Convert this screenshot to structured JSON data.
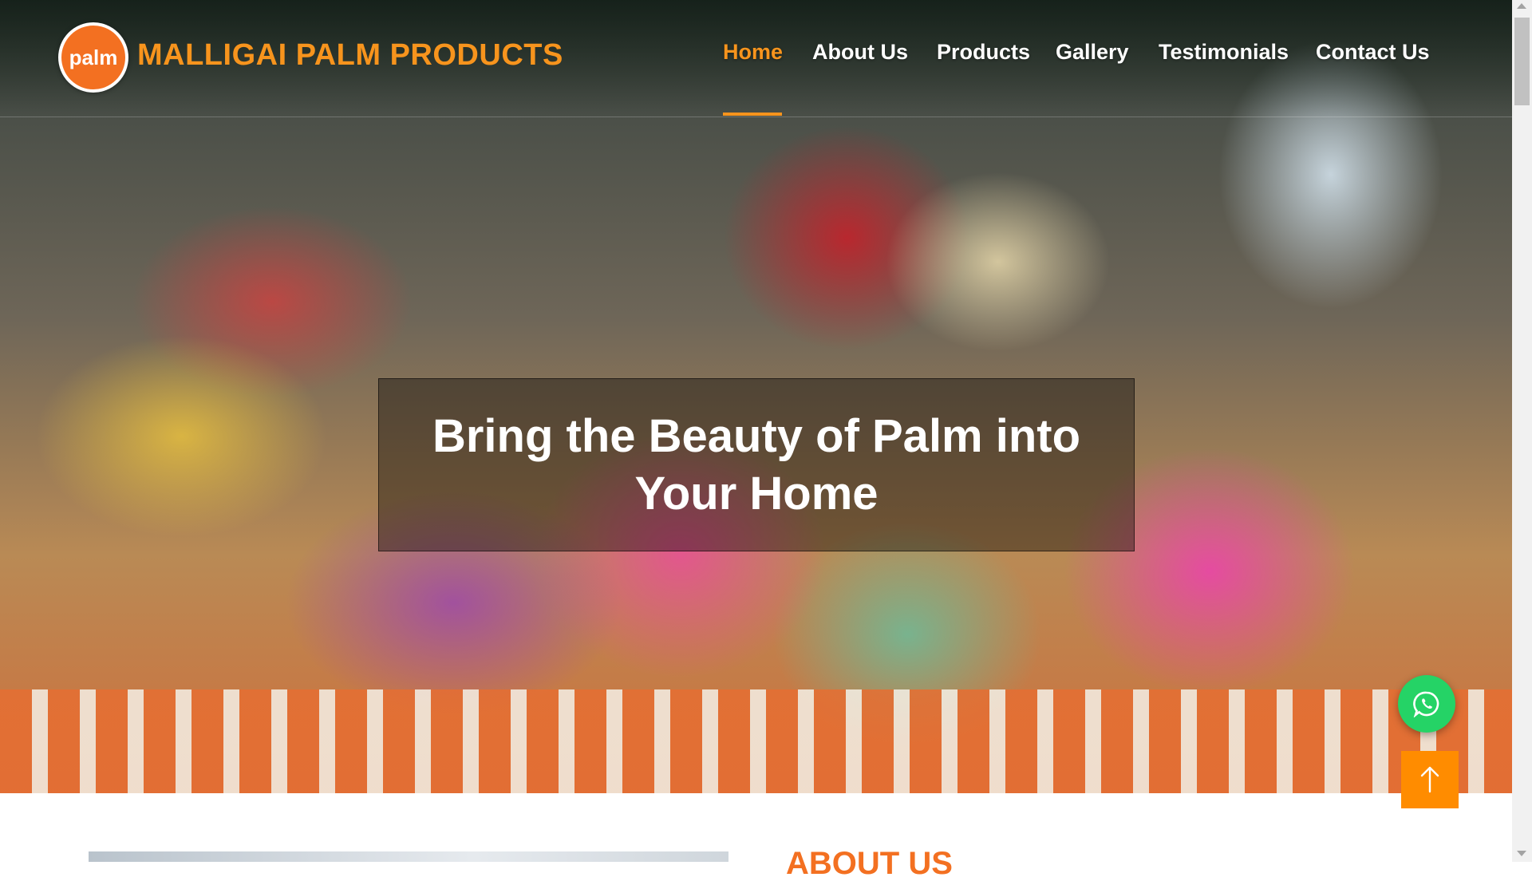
{
  "brand": {
    "logo_text": "palm",
    "name": "MALLIGAI PALM PRODUCTS"
  },
  "nav": {
    "items": [
      {
        "label": "Home",
        "active": true
      },
      {
        "label": "About Us",
        "active": false
      },
      {
        "label": "Products",
        "active": false
      },
      {
        "label": "Gallery",
        "active": false
      },
      {
        "label": "Testimonials",
        "active": false
      },
      {
        "label": "Contact Us",
        "active": false
      }
    ]
  },
  "hero": {
    "headline": "Bring the Beauty of Palm into Your Home"
  },
  "floating": {
    "whatsapp_icon": "whatsapp-icon",
    "back_to_top_icon": "arrow-up-icon"
  },
  "about": {
    "heading": "ABOUT US"
  },
  "colors": {
    "accent": "#f7941d",
    "whatsapp": "#25d366",
    "back_to_top": "#ff8c00"
  }
}
